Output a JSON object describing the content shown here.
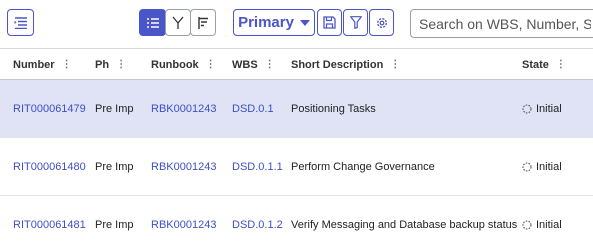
{
  "toolbar": {
    "menu_icon": "list-indent-icon",
    "view_list_icon": "list-icon",
    "view_tree_icon": "fork-icon",
    "view_gantt_icon": "gantt-icon",
    "primary_label": "Primary",
    "save_icon": "floppy-icon",
    "filter_icon": "filter-icon",
    "settings_icon": "gear-icon",
    "search_placeholder": "Search on WBS, Number, Short Description"
  },
  "table": {
    "columns": [
      "Number",
      "Ph",
      "Runbook",
      "WBS",
      "Short Description",
      "State"
    ],
    "column_menu_icon": "kebab-icon",
    "rows": [
      {
        "number": "RIT000061479",
        "ph": "Pre Imp",
        "runbook": "RBK0001243",
        "wbs": "DSD.0.1",
        "description": "Positioning Tasks",
        "state": "Initial",
        "selected": true
      },
      {
        "number": "RIT000061480",
        "ph": "Pre Imp",
        "runbook": "RBK0001243",
        "wbs": "DSD.0.1.1",
        "description": "Perform Change Governance",
        "state": "Initial",
        "selected": false
      },
      {
        "number": "RIT000061481",
        "ph": "Pre Imp",
        "runbook": "RBK0001243",
        "wbs": "DSD.0.1.2",
        "description": "Verify Messaging and Database backup status",
        "state": "Initial",
        "selected": false
      }
    ]
  },
  "colors": {
    "accent": "#4a55c9",
    "selected_row": "#dfe3f5",
    "link": "#3d4fc4"
  }
}
